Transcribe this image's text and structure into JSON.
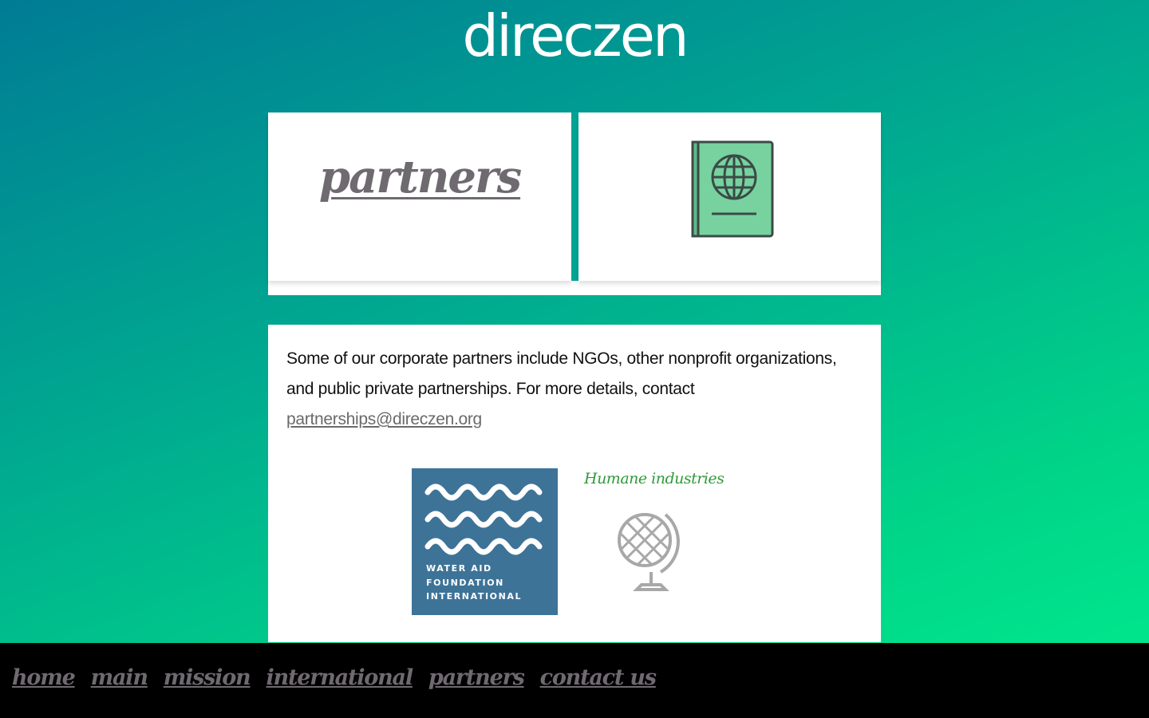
{
  "header": {
    "brand": "direczen"
  },
  "hero": {
    "title": "partners",
    "icon": "passport-icon"
  },
  "content": {
    "paragraph": "Some of our corporate partners include NGOs, other nonprofit organizations, and public private partnerships. For more details, contact ",
    "email": "partnerships@direczen.org",
    "partners": [
      {
        "name": "water-aid-logo",
        "lines": [
          "WATER AID",
          "FOUNDATION",
          "INTERNATIONAL"
        ]
      },
      {
        "name": "humane-industries-logo",
        "title": "Humane industries",
        "icon": "globe-icon"
      }
    ]
  },
  "footer": {
    "nav": [
      {
        "label": "home"
      },
      {
        "label": "main"
      },
      {
        "label": "mission"
      },
      {
        "label": "international"
      },
      {
        "label": "partners"
      },
      {
        "label": "contact us"
      }
    ]
  },
  "colors": {
    "gradient_start": "#007c95",
    "gradient_end": "#00ec8e",
    "link_gray": "#6f6a70",
    "passport_green": "#77d2a0",
    "water_blue": "#3e7398",
    "humane_green": "#2f9a3a"
  }
}
